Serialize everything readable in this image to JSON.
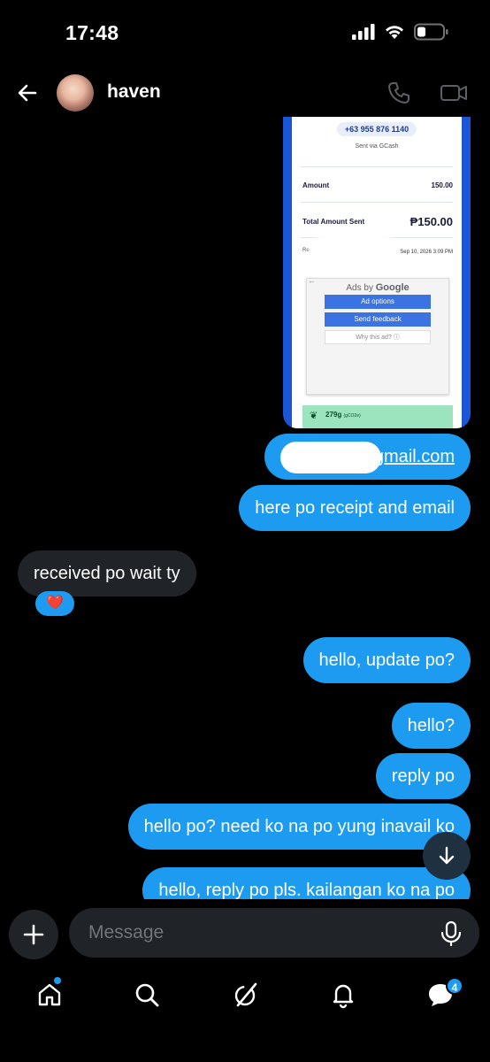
{
  "status_bar": {
    "time": "17:48",
    "icons": [
      "signal-icon",
      "wifi-icon",
      "battery-icon"
    ]
  },
  "header": {
    "contact_name": "haven",
    "icons": [
      "back-arrow-icon",
      "phone-icon",
      "video-icon"
    ]
  },
  "receipt": {
    "phone": "+63 955 876 1140",
    "sent_via": "Sent via GCash",
    "amount_label": "Amount",
    "amount_value": "150.00",
    "total_label": "Total Amount Sent",
    "total_value": "₱150.00",
    "ref_prefix": "Re",
    "date": "Sep 10, 2026 3:09 PM",
    "ad_back": "←",
    "ad_title_prefix": "Ads by",
    "ad_title_brand": "Google",
    "ad_options": "Ad options",
    "send_feedback": "Send feedback",
    "why_this_ad": "Why this ad? ⓘ",
    "green_text": "279g",
    "green_sub": "(gCO2e)"
  },
  "messages": [
    {
      "dir": "out",
      "text": "gmail.com",
      "redacted_prefix": true
    },
    {
      "dir": "out",
      "text": "here po receipt and email"
    },
    {
      "dir": "in",
      "text": "received po wait ty",
      "reaction": "❤️"
    },
    {
      "dir": "out",
      "text": "hello, update po?"
    },
    {
      "dir": "out",
      "text": "hello?"
    },
    {
      "dir": "out",
      "text": "reply po"
    },
    {
      "dir": "out",
      "text": "hello po? need ko na po yung inavail ko"
    },
    {
      "dir": "out",
      "text": "hello, reply po pls. kailangan ko na po"
    }
  ],
  "composer": {
    "placeholder": "Message",
    "icons": [
      "plus-icon",
      "microphone-icon"
    ]
  },
  "bottom_nav": {
    "items": [
      "home-icon",
      "search-icon",
      "grok-icon",
      "notifications-icon",
      "messages-icon"
    ],
    "messages_badge": "4"
  },
  "colors": {
    "accent": "#1d9bf0",
    "incoming_bubble": "#202327",
    "background": "#000000"
  }
}
